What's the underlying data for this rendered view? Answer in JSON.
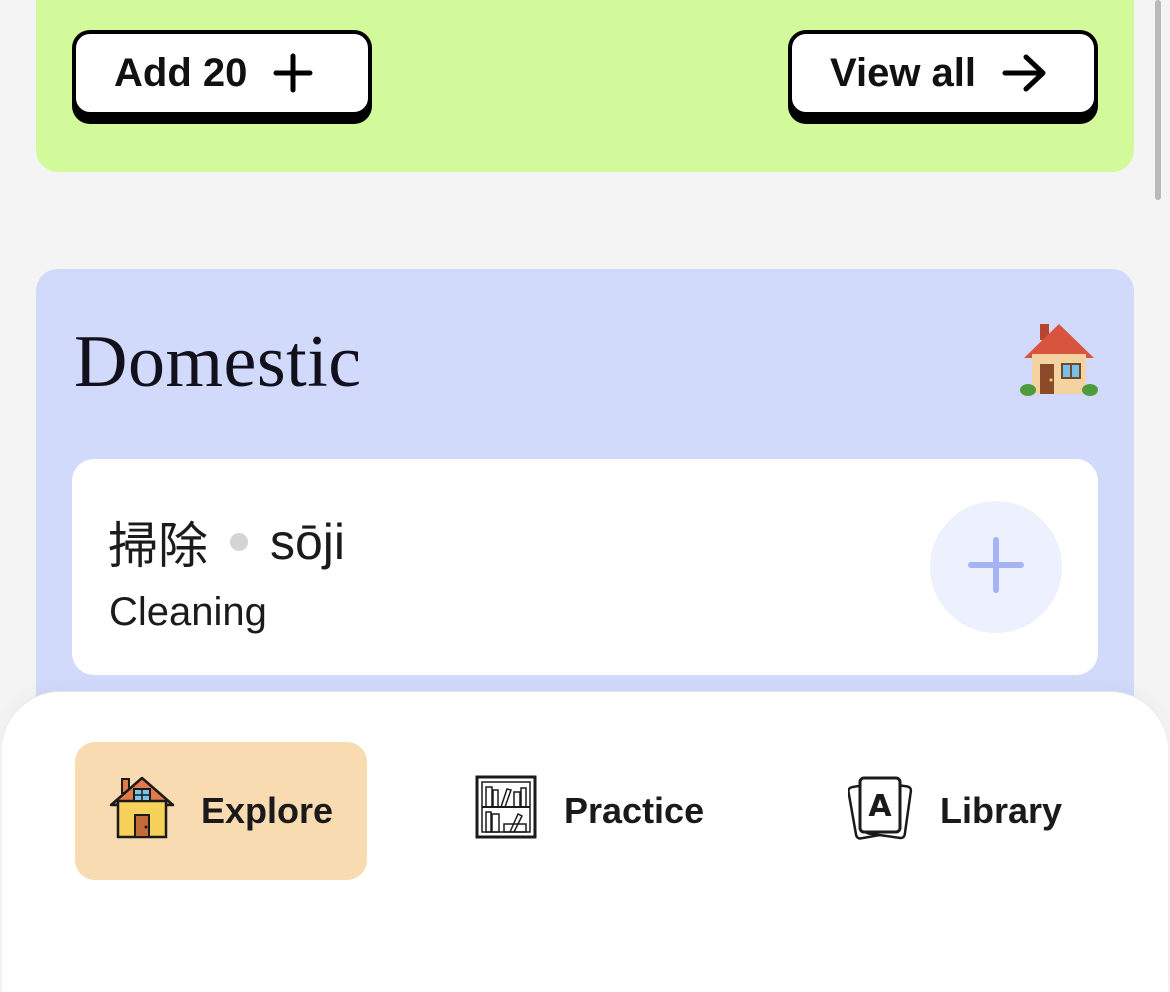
{
  "top_card": {
    "add_label": "Add 20",
    "view_label": "View all"
  },
  "section": {
    "title": "Domestic",
    "icon": "house-emoji"
  },
  "word": {
    "kanji": "掃除",
    "romaji": "sōji",
    "meaning": "Cleaning"
  },
  "nav": {
    "explore": "Explore",
    "practice": "Practice",
    "library": "Library"
  },
  "colors": {
    "green_card": "#d3fa9a",
    "blue_card": "#d2dafb",
    "explore_active": "#f9dbb1",
    "plus_accent": "#a5b3f5"
  }
}
